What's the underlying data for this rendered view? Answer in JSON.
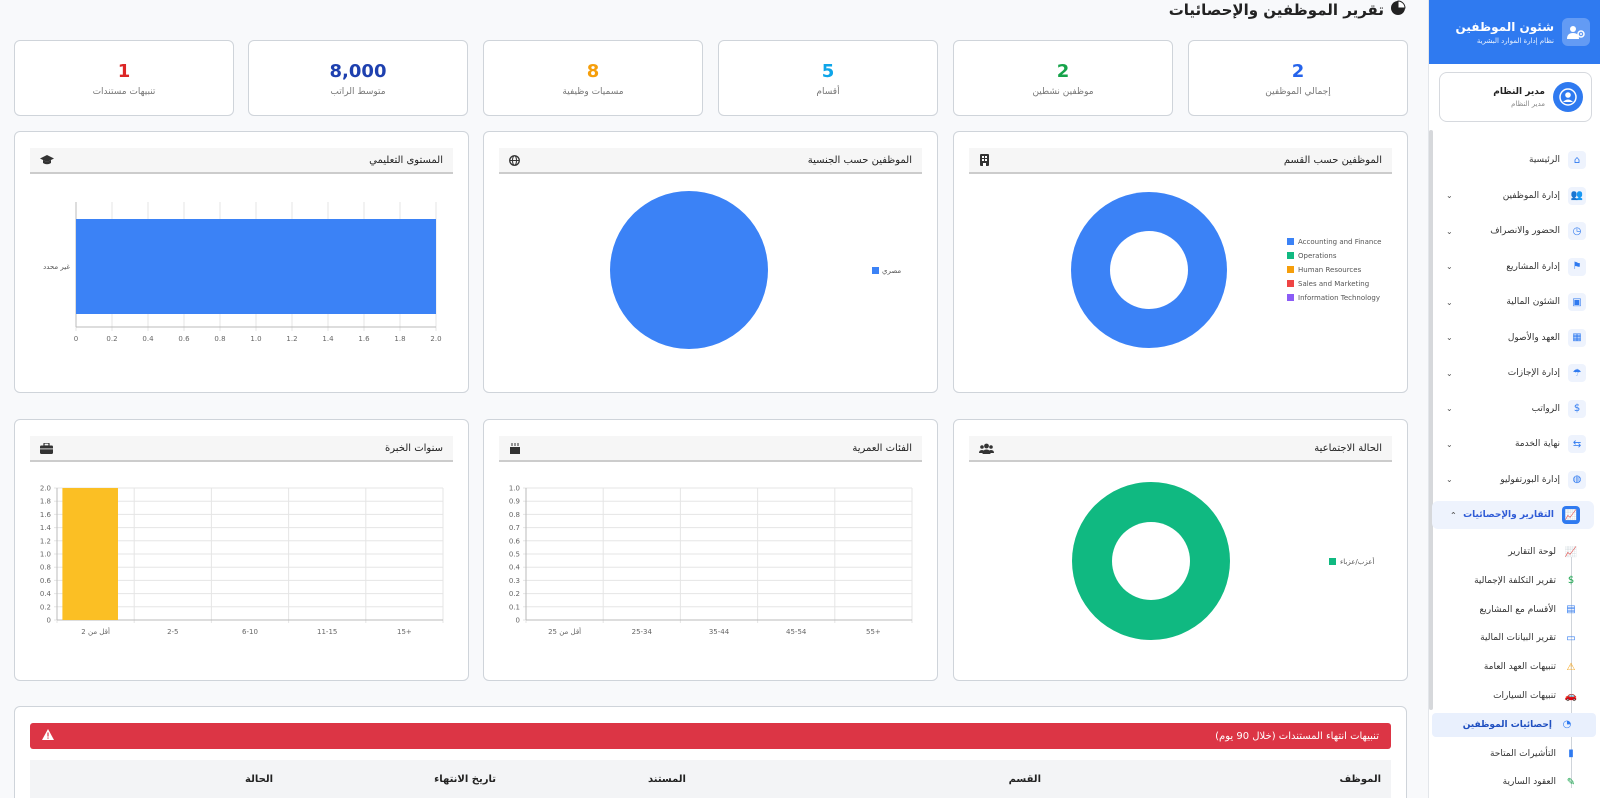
{
  "page": {
    "title": "تقرير الموظفين والإحصائيات"
  },
  "stats": [
    {
      "value": "2",
      "label": "إجمالي الموظفين",
      "color": "#2563eb"
    },
    {
      "value": "2",
      "label": "موظفين نشطين",
      "color": "#16a34a"
    },
    {
      "value": "5",
      "label": "أقسام",
      "color": "#0ea5e9"
    },
    {
      "value": "8",
      "label": "مسميات وظيفية",
      "color": "#f59e0b"
    },
    {
      "value": "8,000",
      "label": "متوسط الراتب",
      "color": "#1e40af"
    },
    {
      "value": "1",
      "label": "تنبيهات مستندات",
      "color": "#dc2626"
    }
  ],
  "cards": {
    "dept": {
      "title": "الموظفين حسب القسم"
    },
    "nationality": {
      "title": "الموظفين حسب الجنسية"
    },
    "education": {
      "title": "المستوى التعليمي"
    },
    "marital": {
      "title": "الحالة الاجتماعية"
    },
    "age": {
      "title": "الفئات العمرية"
    },
    "experience": {
      "title": "سنوات الخبرة"
    }
  },
  "chart_data": [
    {
      "type": "pie",
      "variant": "doughnut",
      "categories": [
        "Accounting and Finance",
        "Operations",
        "Human Resources",
        "Sales and Marketing",
        "Information Technology"
      ],
      "values": [
        2,
        0,
        0,
        0,
        0
      ],
      "colors": [
        "#3b82f6",
        "#10b981",
        "#f59e0b",
        "#ef4444",
        "#8b5cf6"
      ],
      "legend": "right"
    },
    {
      "type": "pie",
      "categories": [
        "مصري"
      ],
      "values": [
        2
      ],
      "colors": [
        "#3b82f6"
      ],
      "legend": "right"
    },
    {
      "type": "bar",
      "orientation": "horizontal",
      "categories": [
        "غير محدد"
      ],
      "values": [
        2
      ],
      "xlim": [
        0,
        2
      ],
      "xticks": [
        "0",
        "0.2",
        "0.4",
        "0.6",
        "0.8",
        "1.0",
        "1.2",
        "1.4",
        "1.6",
        "1.8",
        "2.0"
      ],
      "color": "#3b82f6"
    },
    {
      "type": "pie",
      "variant": "doughnut",
      "categories": [
        "أعزب/عزباء"
      ],
      "values": [
        2
      ],
      "colors": [
        "#10b981"
      ],
      "legend": "right"
    },
    {
      "type": "bar",
      "categories": [
        "أقل من 25",
        "25-34",
        "35-44",
        "45-54",
        "55+"
      ],
      "values": [
        0,
        0,
        0,
        0,
        0
      ],
      "ylim": [
        0,
        1
      ],
      "yticks": [
        "0",
        "0.1",
        "0.2",
        "0.3",
        "0.4",
        "0.5",
        "0.6",
        "0.7",
        "0.8",
        "0.9",
        "1.0"
      ]
    },
    {
      "type": "bar",
      "categories": [
        "أقل من 2",
        "2-5",
        "6-10",
        "11-15",
        "15+"
      ],
      "values": [
        2,
        0,
        0,
        0,
        0
      ],
      "ylim": [
        0,
        2
      ],
      "yticks": [
        "0",
        "0.2",
        "0.4",
        "0.6",
        "0.8",
        "1.0",
        "1.2",
        "1.4",
        "1.6",
        "1.8",
        "2.0"
      ],
      "color": "#fbbf24"
    }
  ],
  "alert": {
    "title": "تنبيهات انتهاء المستندات (خلال 90 يوم)",
    "columns": [
      "الموظف",
      "القسم",
      "المستند",
      "تاريخ الانتهاء",
      "الحالة"
    ]
  },
  "sidebar": {
    "title": "شئون الموظفين",
    "subtitle": "نظام إدارة الموارد البشرية",
    "user": {
      "name": "مدير النظام",
      "role": "مدير النظام"
    },
    "items": [
      {
        "label": "الرئيسية",
        "icon": "home-icon"
      },
      {
        "label": "إدارة الموظفين",
        "icon": "users-icon"
      },
      {
        "label": "الحضور والانصراف",
        "icon": "clock-icon"
      },
      {
        "label": "إدارة المشاريع",
        "icon": "project-icon"
      },
      {
        "label": "الشئون المالية",
        "icon": "money-icon"
      },
      {
        "label": "العهد والأصول",
        "icon": "assets-icon"
      },
      {
        "label": "إدارة الإجازات",
        "icon": "vacation-icon"
      },
      {
        "label": "الرواتب",
        "icon": "payroll-icon"
      },
      {
        "label": "نهاية الخدمة",
        "icon": "handshake-icon"
      },
      {
        "label": "إدارة البورتفوليو",
        "icon": "globe-icon"
      },
      {
        "label": "التقارير والإحصائيات",
        "icon": "chart-line-icon"
      }
    ],
    "subitems": [
      {
        "label": "لوحة التقارير",
        "icon": "chart-line-icon"
      },
      {
        "label": "تقرير التكلفة الإجمالية",
        "icon": "file-dollar-icon"
      },
      {
        "label": "الأقسام مع المشاريع",
        "icon": "building-icon"
      },
      {
        "label": "تقرير البيانات المالية",
        "icon": "id-card-icon"
      },
      {
        "label": "تنبيهات العهد العامة",
        "icon": "warning-icon"
      },
      {
        "label": "تنبيهات السيارات",
        "icon": "car-icon"
      },
      {
        "label": "إحصائيات الموظفين",
        "icon": "pie-chart-icon"
      },
      {
        "label": "التأشيرات المتاحة",
        "icon": "passport-icon"
      },
      {
        "label": "العقود السارية",
        "icon": "contract-icon"
      }
    ]
  }
}
